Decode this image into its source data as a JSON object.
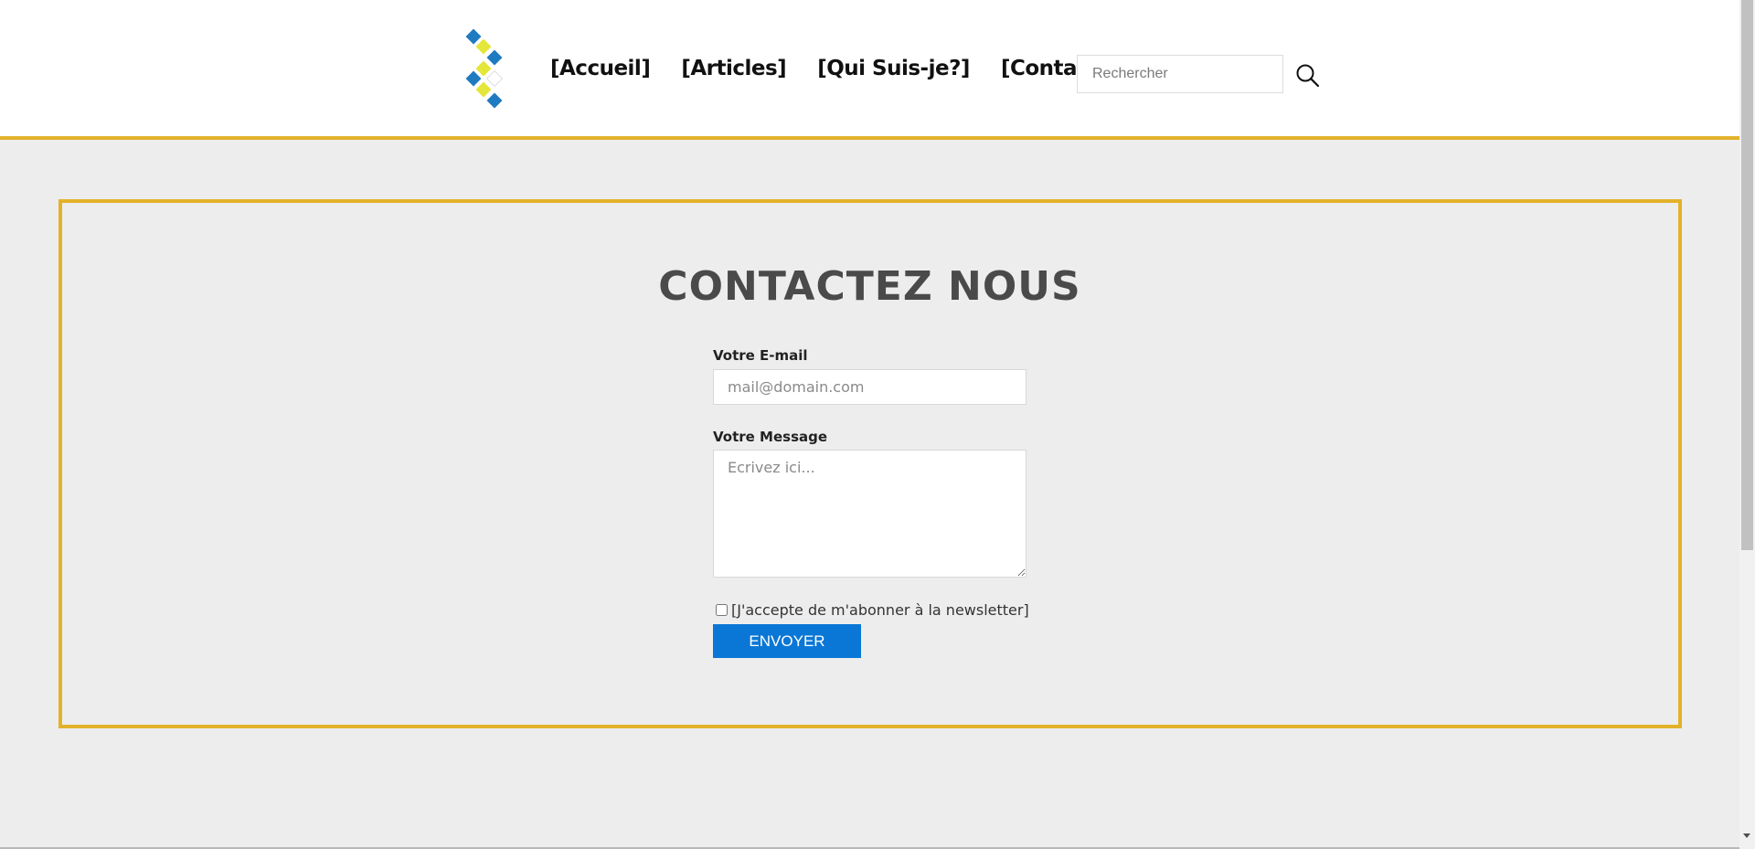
{
  "header": {
    "nav": [
      {
        "label": "[Accueil]"
      },
      {
        "label": "[Articles]"
      },
      {
        "label": "[Qui Suis-je?]"
      },
      {
        "label": "[Contact]"
      }
    ],
    "search": {
      "placeholder": "Rechercher",
      "icon": "search-icon"
    },
    "logo": {
      "icon": "diamond-chevron-logo",
      "colors": {
        "blue": "#1f7bc0",
        "yellow": "#e4e63a"
      }
    }
  },
  "main": {
    "title": "CONTACTEZ NOUS",
    "form": {
      "email_label": "Votre E-mail",
      "email_placeholder": "mail@domain.com",
      "message_label": "Votre Message",
      "message_placeholder": "Ecrivez ici...",
      "newsletter_label": "[J'accepte de m'abonner à la newsletter]",
      "newsletter_checked": false,
      "submit_label": "ENVOYER"
    }
  },
  "colors": {
    "accent": "#e2b22a",
    "button": "#0a77d6",
    "background": "#ededed"
  }
}
